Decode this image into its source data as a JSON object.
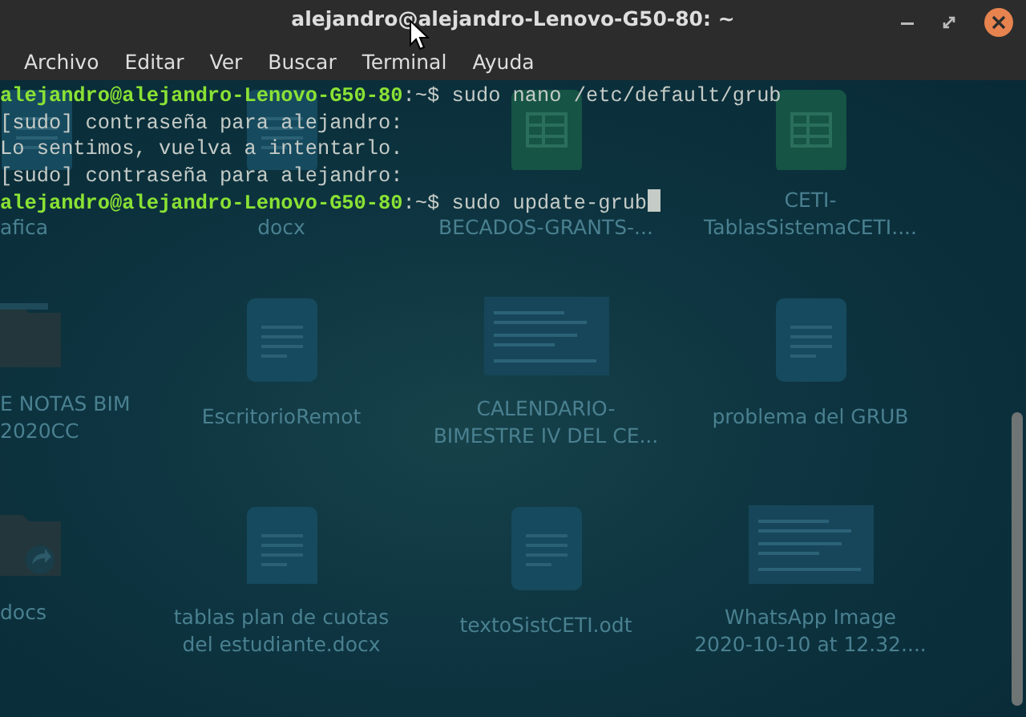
{
  "window": {
    "title": "alejandro@alejandro-Lenovo-G50-80: ~"
  },
  "menu": [
    "Archivo",
    "Editar",
    "Ver",
    "Buscar",
    "Terminal",
    "Ayuda"
  ],
  "terminal": {
    "lines": [
      {
        "kind": "prompt",
        "user_host": "alejandro@alejandro-Lenovo-G50-80",
        "suffix": ":~$",
        "command": "sudo nano /etc/default/grub"
      },
      {
        "kind": "output",
        "text": "[sudo] contraseña para alejandro:"
      },
      {
        "kind": "output",
        "text": "Lo sentimos, vuelva a intentarlo."
      },
      {
        "kind": "output",
        "text": "[sudo] contraseña para alejandro:"
      },
      {
        "kind": "prompt",
        "user_host": "alejandro@alejandro-Lenovo-G50-80",
        "suffix": ":~$",
        "command": "sudo update-grub"
      }
    ]
  },
  "desktop": {
    "rows": [
      [
        {
          "kind": "document",
          "label": [
            "afica"
          ]
        },
        {
          "kind": "document",
          "label": [
            "docx"
          ]
        },
        {
          "kind": "spreadsheet",
          "label": [
            "BECADOS-GRANTS-..."
          ]
        },
        {
          "kind": "spreadsheet",
          "label": [
            "CETI-",
            "TablasSistemaCETI...."
          ]
        }
      ],
      [
        {
          "kind": "folder",
          "label": [
            "E NOTAS BIM",
            "2020CC"
          ]
        },
        {
          "kind": "document",
          "label": [
            "EscritorioRemot"
          ]
        },
        {
          "kind": "image",
          "label": [
            "CALENDARIO-",
            "BIMESTRE IV DEL CE..."
          ]
        },
        {
          "kind": "document",
          "label": [
            "problema del GRUB"
          ]
        }
      ],
      [
        {
          "kind": "folder-link",
          "label": [
            "docs"
          ]
        },
        {
          "kind": "document",
          "label": [
            "tablas plan de cuotas",
            "del estudiante.docx"
          ]
        },
        {
          "kind": "document",
          "label": [
            "textoSistCETI.odt"
          ]
        },
        {
          "kind": "image",
          "label": [
            "WhatsApp Image",
            "2020-10-10 at 12.32...."
          ]
        }
      ]
    ]
  }
}
